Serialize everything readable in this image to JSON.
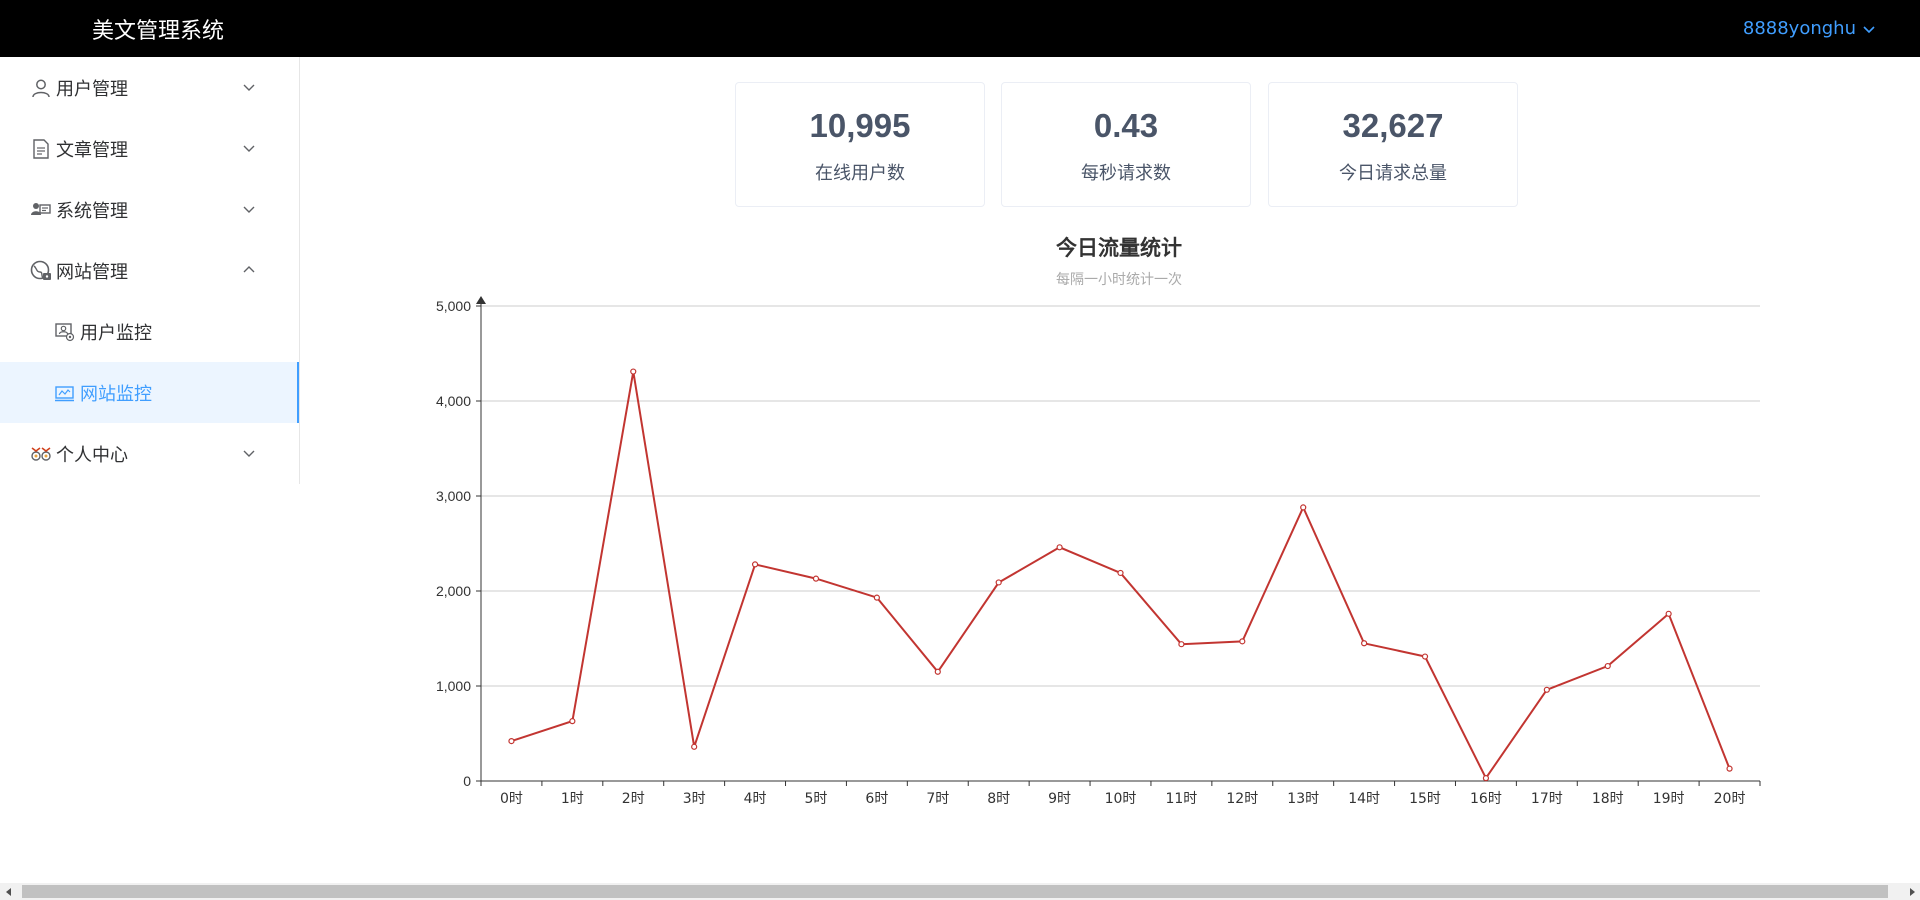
{
  "header": {
    "title": "美文管理系统",
    "username": "8888yonghu"
  },
  "sidebar": {
    "items": [
      {
        "label": "用户管理",
        "icon": "user-icon",
        "expanded": false
      },
      {
        "label": "文章管理",
        "icon": "document-icon",
        "expanded": false
      },
      {
        "label": "系统管理",
        "icon": "system-icon",
        "expanded": false
      },
      {
        "label": "网站管理",
        "icon": "website-icon",
        "expanded": true,
        "children": [
          {
            "label": "用户监控",
            "icon": "user-monitor-icon",
            "active": false
          },
          {
            "label": "网站监控",
            "icon": "site-monitor-icon",
            "active": true
          }
        ]
      },
      {
        "label": "个人中心",
        "icon": "personal-icon",
        "expanded": false
      }
    ]
  },
  "stats": [
    {
      "value": "10,995",
      "label": "在线用户数"
    },
    {
      "value": "0.43",
      "label": "每秒请求数"
    },
    {
      "value": "32,627",
      "label": "今日请求总量"
    }
  ],
  "colors": {
    "accent": "#409eff",
    "line": "#c23531",
    "header_bg": "#000000"
  },
  "chart_data": {
    "type": "line",
    "title": "今日流量统计",
    "subtitle": "每隔一小时统计一次",
    "categories": [
      "0时",
      "1时",
      "2时",
      "3时",
      "4时",
      "5时",
      "6时",
      "7时",
      "8时",
      "9时",
      "10时",
      "11时",
      "12时",
      "13时",
      "14时",
      "15时",
      "16时",
      "17时",
      "18时",
      "19时",
      "20时"
    ],
    "values": [
      420,
      630,
      4310,
      360,
      2280,
      2130,
      1930,
      1150,
      2090,
      2460,
      2190,
      1440,
      1470,
      2880,
      1450,
      1310,
      30,
      960,
      1210,
      1760,
      130
    ],
    "ylim": [
      0,
      5000
    ],
    "yticks": [
      0,
      1000,
      2000,
      3000,
      4000,
      5000
    ],
    "ytick_labels": [
      "0",
      "1,000",
      "2,000",
      "3,000",
      "4,000",
      "5,000"
    ],
    "grid": true,
    "legend": "none"
  }
}
